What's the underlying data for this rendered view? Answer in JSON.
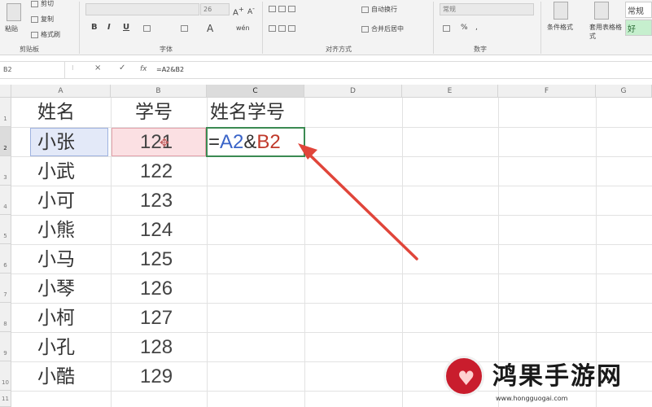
{
  "ribbon": {
    "clipboard": {
      "paste": "粘贴",
      "cut": "剪切",
      "copy": "复制",
      "painter": "格式刷",
      "label": "剪贴板"
    },
    "font": {
      "size": "26",
      "label": "字体",
      "bold": "B",
      "italic": "I",
      "underline": "U",
      "font_color": "A",
      "phonetic": "wén"
    },
    "alignment": {
      "wrap": "自动换行",
      "merge": "合并后居中",
      "label": "对齐方式"
    },
    "number": {
      "format": "常规",
      "percent": "%",
      "comma": ",",
      "label": "数字"
    },
    "styles": {
      "conditional": "条件格式",
      "table": "套用表格格式",
      "normal": "常规",
      "good": "好"
    }
  },
  "formula_bar": {
    "name_box": "B2",
    "cancel": "×",
    "enter": "✓",
    "fx": "fx",
    "formula": "=A2&B2"
  },
  "columns": [
    "A",
    "B",
    "C",
    "D",
    "E",
    "F",
    "G"
  ],
  "rows": [
    "1",
    "2",
    "3",
    "4",
    "5",
    "6",
    "7",
    "8",
    "9",
    "10",
    "11"
  ],
  "sheet": {
    "header": {
      "name": "姓名",
      "id": "学号",
      "combined": "姓名学号"
    },
    "records": [
      {
        "name": "小张",
        "id": "121"
      },
      {
        "name": "小武",
        "id": "122"
      },
      {
        "name": "小可",
        "id": "123"
      },
      {
        "name": "小熊",
        "id": "124"
      },
      {
        "name": "小马",
        "id": "125"
      },
      {
        "name": "小琴",
        "id": "126"
      },
      {
        "name": "小柯",
        "id": "127"
      },
      {
        "name": "小孔",
        "id": "128"
      },
      {
        "name": "小酷",
        "id": "129"
      }
    ],
    "formula_parts": {
      "eq": "=",
      "a2": "A2",
      "amp": "&",
      "b2": "B2"
    }
  },
  "watermark": {
    "title": "鸿果手游网",
    "url": "www.hongguogai.com"
  },
  "colors": {
    "selection_border": "#3b8a52",
    "a_ref": "#3a64c8",
    "b_ref": "#c0392b",
    "arrow": "#e0453a",
    "watermark_red": "#c91d2d"
  }
}
